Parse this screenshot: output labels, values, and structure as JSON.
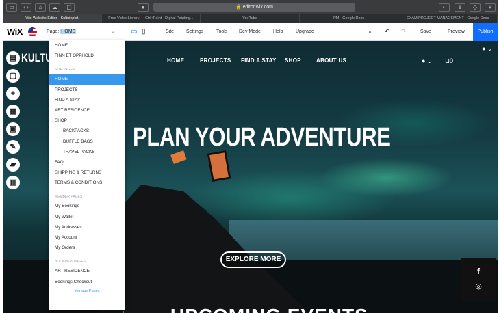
{
  "browser": {
    "url": "editor.wix.com",
    "tabs": [
      {
        "label": "Wix Website Editor - Kultuinplet",
        "active": true
      },
      {
        "label": "Free Video Library — Ctrl+Paint - Digital Painting...",
        "active": false
      },
      {
        "label": "YouTube",
        "active": false
      },
      {
        "label": "PM - Google Docs",
        "active": false
      },
      {
        "label": "EXAM PROJECT MANAGEMENT - Google Docs",
        "active": false
      }
    ]
  },
  "wixbar": {
    "logo": "WiX",
    "page_prefix": "Page:",
    "page_value": "HOME",
    "menu": [
      "Site",
      "Settings",
      "Tools",
      "Dev Mode",
      "Help",
      "Upgrade"
    ],
    "save": "Save",
    "preview": "Preview",
    "publish": "Publish"
  },
  "pages_panel": {
    "top_items": [
      "HOME",
      "FINN ET OPPHOLD"
    ],
    "site_pages_header": "SITE PAGES",
    "site_pages": [
      {
        "label": "HOME",
        "sub": false,
        "selected": true
      },
      {
        "label": "PROJECTS",
        "sub": false,
        "selected": false
      },
      {
        "label": "FIND A STAY",
        "sub": false,
        "selected": false
      },
      {
        "label": "ART RESIDENCE",
        "sub": false,
        "selected": false
      },
      {
        "label": "SHOP",
        "sub": false,
        "selected": false
      },
      {
        "label": "BACKPACKS",
        "sub": true,
        "selected": false
      },
      {
        "label": "DUFFLE BAGS",
        "sub": true,
        "selected": false
      },
      {
        "label": "TRAVEL PACKS",
        "sub": true,
        "selected": false
      },
      {
        "label": "FAQ",
        "sub": false,
        "selected": false
      },
      {
        "label": "SHIPPING & RETURNS",
        "sub": false,
        "selected": false
      },
      {
        "label": "TERMS & CONDITIONS",
        "sub": false,
        "selected": false
      }
    ],
    "member_pages_header": "MEMBER PAGES",
    "member_pages": [
      "My Bookings",
      "My Wallet",
      "My Addresses",
      "My Account",
      "My Orders"
    ],
    "booking_pages_header": "BOOKINGS PAGES",
    "booking_pages": [
      "ART RESIDENCE",
      "Bookings Checkout"
    ],
    "manage": "Manage Pages"
  },
  "site": {
    "brand": "KULTU",
    "nav": [
      "HOME",
      "PROJECTS",
      "FIND A STAY",
      "SHOP",
      "ABOUT US"
    ],
    "cart_count": "0",
    "hero_title": "PLAN YOUR ADVENTURE",
    "cta": "EXPLORE MORE",
    "section_title": "UPCOMING EVENTS"
  },
  "social": {
    "facebook": "f",
    "instagram": "◎"
  }
}
